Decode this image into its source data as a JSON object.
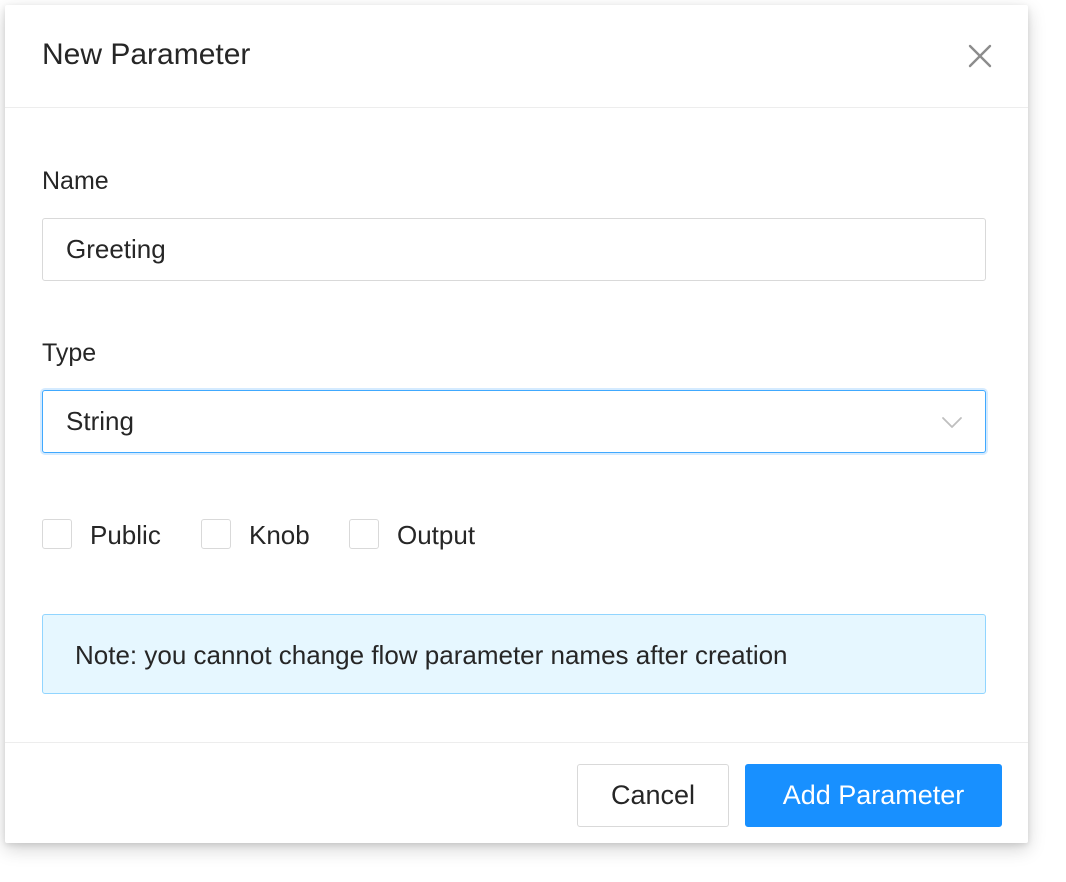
{
  "dialog": {
    "title": "New Parameter",
    "close_icon": "close-icon"
  },
  "form": {
    "name": {
      "label": "Name",
      "value": "Greeting"
    },
    "type": {
      "label": "Type",
      "selected": "String",
      "arrow_icon": "chevron-down-icon"
    },
    "checkboxes": [
      {
        "label": "Public",
        "checked": false
      },
      {
        "label": "Knob",
        "checked": false
      },
      {
        "label": "Output",
        "checked": false
      }
    ],
    "note": "Note: you cannot change flow parameter names after creation"
  },
  "footer": {
    "cancel_label": "Cancel",
    "submit_label": "Add Parameter"
  },
  "colors": {
    "primary": "#1890ff",
    "focus_border": "#40a9ff",
    "info_bg": "#e6f7ff",
    "info_border": "#91d5ff",
    "text": "#262626",
    "border": "#d9d9d9"
  }
}
